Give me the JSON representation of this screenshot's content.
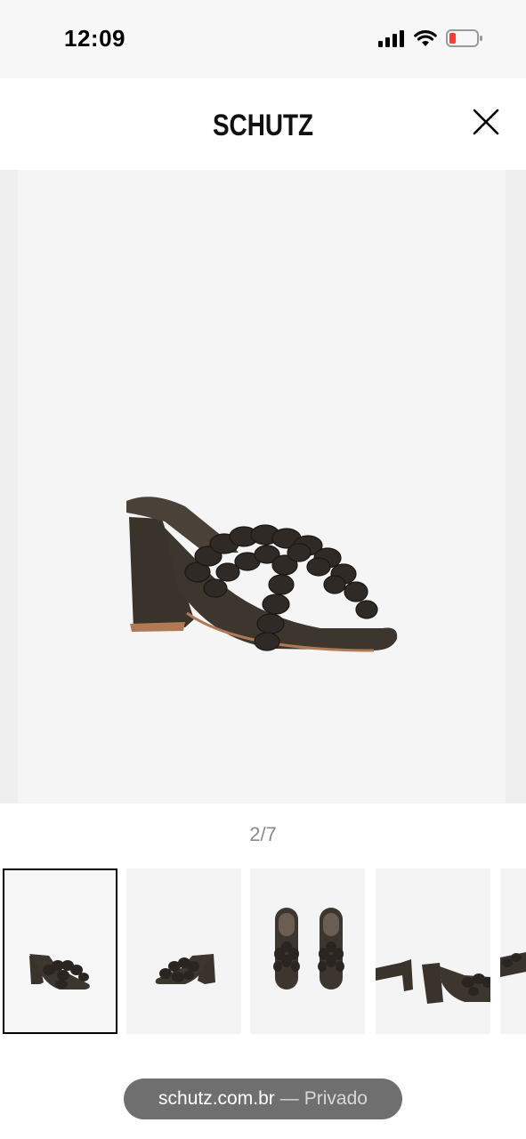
{
  "status_bar": {
    "time": "12:09",
    "icons": [
      "cellular-signal-icon",
      "wifi-icon",
      "battery-low-icon"
    ],
    "battery_color": "#ff3b30"
  },
  "header": {
    "brand": "SCHUTZ",
    "close_icon": "close-icon"
  },
  "gallery": {
    "pager": "2/7",
    "current_index": 2,
    "total": 7,
    "thumbnails": [
      {
        "view": "side",
        "selected": true
      },
      {
        "view": "side-mirror",
        "selected": false
      },
      {
        "view": "top-pair",
        "selected": false
      },
      {
        "view": "heel-closeup",
        "selected": false
      },
      {
        "view": "partial",
        "selected": false
      }
    ]
  },
  "browser": {
    "domain": "schutz.com.br",
    "separator": "—",
    "mode": "Privado"
  },
  "colors": {
    "leather": "#3b342d",
    "sole_edge": "#b07a55",
    "pill_bg": "#6f6f6f"
  }
}
